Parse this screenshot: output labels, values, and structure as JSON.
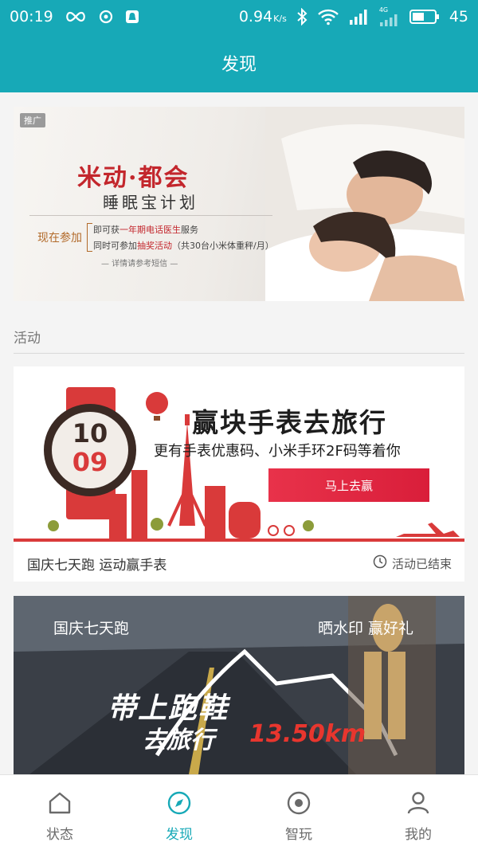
{
  "status_bar": {
    "time": "00:19",
    "speed_value": "0.94",
    "speed_unit": "K/s",
    "network": "4G",
    "battery": "45"
  },
  "app_bar": {
    "title": "发现"
  },
  "promo": {
    "badge": "推广",
    "title": "米动·都会",
    "subtitle": "睡眠宝计划",
    "join_label": "现在参加",
    "line1_a": "即可获",
    "line1_hl": "一年期电话医生",
    "line1_b": "服务",
    "line2_a": "同时可参加",
    "line2_hl": "抽奖活动",
    "line2_b": "（共30台小米体重秤/月）",
    "footnote": "— 详情请参考短信 —"
  },
  "section": {
    "title": "活动"
  },
  "activity1": {
    "banner_title": "赢块手表去旅行",
    "banner_subtitle": "更有手表优惠码、小米手环2F码等着你",
    "button_label": "马上去赢",
    "date_top": "10",
    "date_bottom": "09",
    "name": "国庆七天跑 运动赢手表",
    "status": "活动已结束"
  },
  "activity2": {
    "left_text": "国庆七天跑",
    "right_text": "晒水印 赢好礼",
    "big_line1": "带上跑鞋",
    "big_line2": "去旅行",
    "distance": "13.50km"
  },
  "bottom_nav": {
    "items": [
      {
        "label": "状态",
        "icon": "home-icon"
      },
      {
        "label": "发现",
        "icon": "compass-icon"
      },
      {
        "label": "智玩",
        "icon": "target-icon"
      },
      {
        "label": "我的",
        "icon": "person-icon"
      }
    ],
    "active_index": 1
  },
  "colors": {
    "accent": "#17a9b7",
    "promo_red": "#c3262c",
    "button_red": "#e8324a"
  }
}
